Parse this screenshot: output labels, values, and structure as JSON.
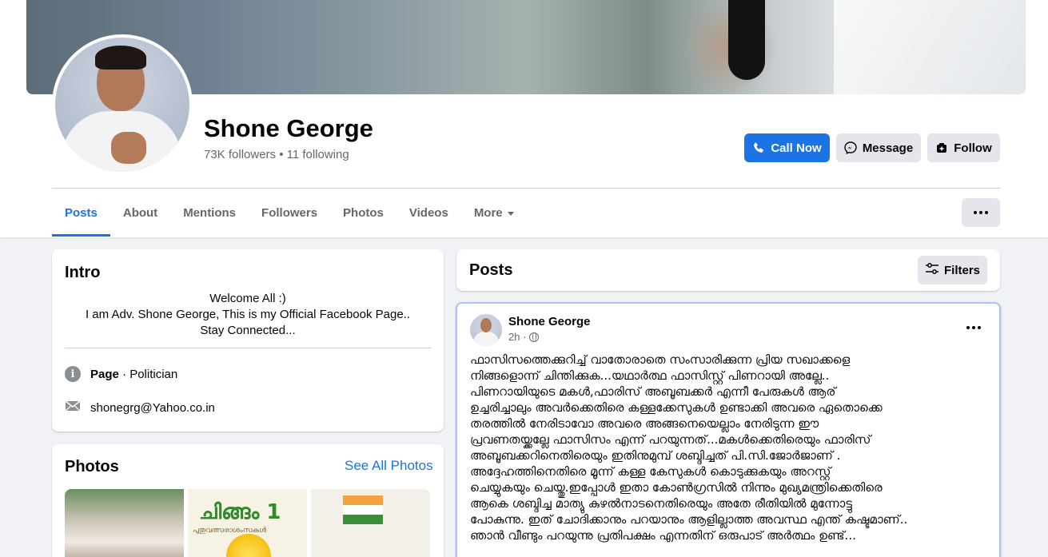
{
  "profile": {
    "name": "Shone George",
    "stats": "73K followers • 11 following"
  },
  "actions": {
    "call": "Call Now",
    "message": "Message",
    "follow": "Follow"
  },
  "tabs": [
    {
      "label": "Posts",
      "active": true
    },
    {
      "label": "About"
    },
    {
      "label": "Mentions"
    },
    {
      "label": "Followers"
    },
    {
      "label": "Photos"
    },
    {
      "label": "Videos"
    },
    {
      "label": "More"
    }
  ],
  "intro": {
    "title": "Intro",
    "bio_lines": [
      "Welcome All :)",
      "I am Adv. Shone George, This is my Official Facebook Page..",
      "Stay Connected..."
    ],
    "page_label": "Page",
    "category": " · Politician",
    "email": "shonegrg@Yahoo.co.in"
  },
  "photos": {
    "title": "Photos",
    "see_all": "See All Photos",
    "thumb2_title": "ചിങ്ങം 1",
    "thumb2_sub": "പുതുവത്സരാശംസകൾ"
  },
  "posts_header": {
    "title": "Posts",
    "filters": "Filters"
  },
  "post": {
    "author": "Shone George",
    "time": "2h ·",
    "text_lines": [
      "ഫാസിസത്തെക്കുറിച്ച് വാതോരാതെ സംസാരിക്കുന്ന പ്രിയ സഖാക്കളെ",
      "നിങ്ങളൊന്ന് ചിന്തിക്കുക...യഥാർത്ഥ ഫാസിസ്റ്റ് പിണറായി അല്ലേ..",
      "പിണറായിയുടെ മകൾ,ഫാരിസ് അബൂബക്കർ എന്നീ പേരുകൾ ആര്",
      "ഉച്ചരിച്ചാലും അവർക്കെതിരെ കള്ളക്കേസുകൾ ഉണ്ടാക്കി അവരെ ഏതൊക്കെ",
      "തരത്തിൽ നേരിടാവോ അവരെ അങ്ങനെയെല്ലാം നേരിടുന്ന ഈ",
      "പ്രവണതയ്ക്കല്ലേ ഫാസിസം എന്ന് പറയുന്നത്...മകൾക്കെതിരെയും ഫാരിസ്",
      "അബൂബക്കറിനെതിരെയും ഇതിനുമുമ്പ് ശബ്ദിച്ചത് പി.സി.ജോർജാണ് .",
      "അദ്ദേഹത്തിനെതിരെ മൂന്ന് കള്ള കേസുകൾ കൊടുക്കുകയും അറസ്റ്റ്",
      "ചെയ്യുകയും ചെയ്തു.ഇപ്പോൾ ഇതാ കോൺഗ്രസിൽ നിന്നും മുഖ്യമന്ത്രിക്കെതിരെ",
      "ആകെ ശബ്ദിച്ച മാത്യു കുഴൽനാടനെതിരെയും അതേ രീതിയിൽ മുന്നോട്ടു",
      "പോകുന്നു. ഇത് ചോദിക്കാനും പറയാനും ആളില്ലാത്ത അവസ്ഥ എന്ത് കഷ്ടമാണ്..",
      "ഞാൻ വീണ്ടും പറയുന്നു പ്രതിപക്ഷം എന്നതിന് ഒരുപാട് അർത്ഥം ഉണ്ട്..."
    ]
  },
  "colors": {
    "accent": "#1b74e4",
    "background": "#f0f2f5",
    "secondary_button": "#e4e6eb",
    "muted_text": "#65676b"
  },
  "icons": {
    "call": "phone-icon",
    "message": "messenger-icon",
    "follow": "follow-plus-icon",
    "filters": "sliders-icon",
    "info": "info-icon",
    "email": "envelope-icon",
    "audience": "globe-icon"
  }
}
